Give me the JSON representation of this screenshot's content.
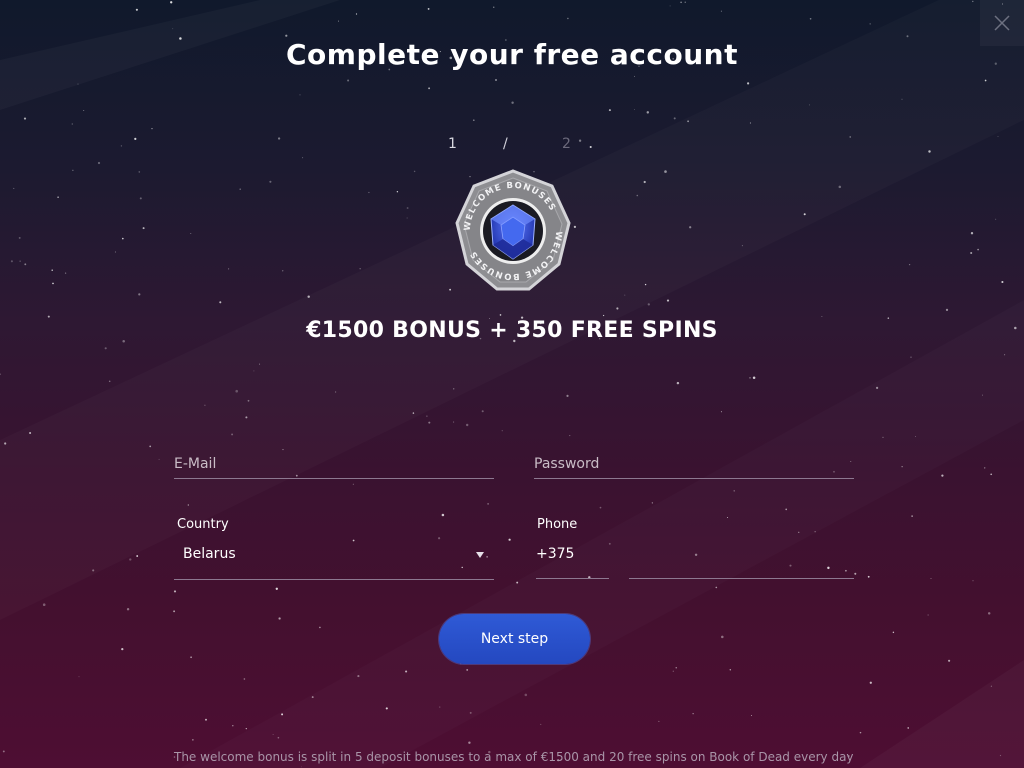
{
  "dialog": {
    "title": "Complete your free account",
    "close_icon": "close-icon",
    "steps": {
      "current": "1",
      "separator": "/",
      "total": "2"
    },
    "badge": {
      "icon": "gem-icon",
      "text": "WELCOME BONUSES"
    },
    "bonus_headline": "€1500 BONUS + 350 FREE SPINS"
  },
  "form": {
    "email": {
      "placeholder": "E-Mail",
      "value": ""
    },
    "password": {
      "placeholder": "Password",
      "value": ""
    },
    "country": {
      "label": "Country",
      "value": "Belarus"
    },
    "phone": {
      "label": "Phone",
      "code": "+375",
      "number": ""
    },
    "next_button": "Next step"
  },
  "footnote": "The welcome bonus is split in 5 deposit bonuses to a max of €1500 and 20 free spins on Book of Dead every day",
  "colors": {
    "button": "#2a50cc",
    "gem": "#3355dd",
    "background_top": "#10192c",
    "background_bottom": "#4e0e33"
  }
}
